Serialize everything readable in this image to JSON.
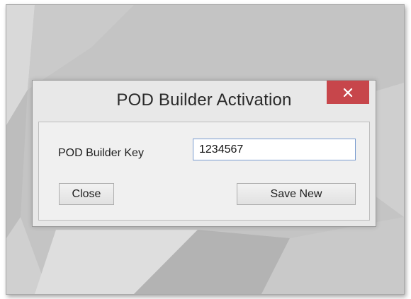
{
  "dialog": {
    "title": "POD Builder Activation",
    "close_glyph": "×",
    "key_label": "POD Builder Key",
    "key_value": "1234567",
    "close_button_label": "Close",
    "save_button_label": "Save New"
  },
  "theme": {
    "close_button_color": "#c7464b",
    "input_border_color": "#7a9ccf",
    "window_background": "#e8e8e8",
    "desktop_background": "#c4c4c4"
  },
  "icons": {
    "title_close": "close-icon"
  }
}
